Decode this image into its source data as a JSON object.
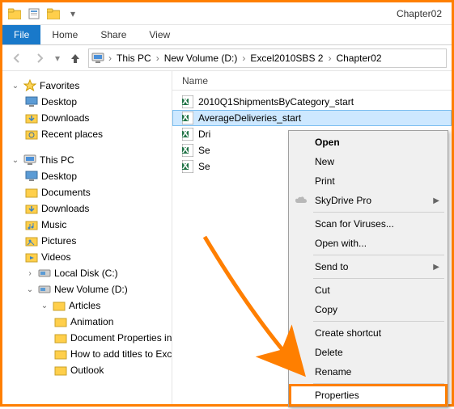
{
  "titlebar": {
    "title": "Chapter02"
  },
  "menubar": {
    "file": "File",
    "home": "Home",
    "share": "Share",
    "view": "View"
  },
  "breadcrumb": {
    "segments": [
      "This PC",
      "New Volume (D:)",
      "Excel2010SBS 2",
      "Chapter02"
    ]
  },
  "columns": {
    "name": "Name"
  },
  "nav": {
    "favorites": {
      "label": "Favorites",
      "items": [
        {
          "label": "Desktop",
          "icon": "desktop"
        },
        {
          "label": "Downloads",
          "icon": "downloads"
        },
        {
          "label": "Recent places",
          "icon": "recent"
        }
      ]
    },
    "thispc": {
      "label": "This PC",
      "items": [
        {
          "label": "Desktop",
          "icon": "desktop"
        },
        {
          "label": "Documents",
          "icon": "folder"
        },
        {
          "label": "Downloads",
          "icon": "downloads"
        },
        {
          "label": "Music",
          "icon": "music"
        },
        {
          "label": "Pictures",
          "icon": "pictures"
        },
        {
          "label": "Videos",
          "icon": "videos"
        },
        {
          "label": "Local Disk (C:)",
          "icon": "drive"
        },
        {
          "label": "New Volume (D:)",
          "icon": "drive",
          "expanded": true,
          "children": [
            {
              "label": "Articles",
              "icon": "folder",
              "expanded": true,
              "children": [
                {
                  "label": "Animation",
                  "icon": "folder"
                },
                {
                  "label": "Document Properties in Excel",
                  "icon": "folder"
                },
                {
                  "label": "How to add titles to Excel charts",
                  "icon": "folder"
                },
                {
                  "label": "Outlook",
                  "icon": "folder"
                }
              ]
            }
          ]
        }
      ]
    }
  },
  "files": [
    {
      "name": "2010Q1ShipmentsByCategory_start",
      "icon": "excel"
    },
    {
      "name": "AverageDeliveries_start",
      "icon": "excel",
      "selected": true
    },
    {
      "name": "DriverSortTimes_start",
      "icon": "excel",
      "truncated": "Dri"
    },
    {
      "name": "Service Levels_start",
      "icon": "excel",
      "truncated": "Se"
    },
    {
      "name": "Series_start",
      "icon": "excel",
      "truncated": "Se"
    }
  ],
  "context_menu": {
    "items": [
      {
        "label": "Open",
        "bold": true
      },
      {
        "label": "New"
      },
      {
        "label": "Print"
      },
      {
        "label": "SkyDrive Pro",
        "icon": "cloud",
        "submenu": true
      },
      {
        "sep": true
      },
      {
        "label": "Scan for Viruses..."
      },
      {
        "label": "Open with..."
      },
      {
        "sep": true
      },
      {
        "label": "Send to",
        "submenu": true
      },
      {
        "sep": true
      },
      {
        "label": "Cut"
      },
      {
        "label": "Copy"
      },
      {
        "sep": true
      },
      {
        "label": "Create shortcut"
      },
      {
        "label": "Delete"
      },
      {
        "label": "Rename"
      },
      {
        "sep": true
      },
      {
        "label": "Properties",
        "highlight": true
      }
    ]
  },
  "colors": {
    "accent": "#1979ca",
    "highlight": "#ff7f00",
    "selection": "#cde8ff"
  }
}
